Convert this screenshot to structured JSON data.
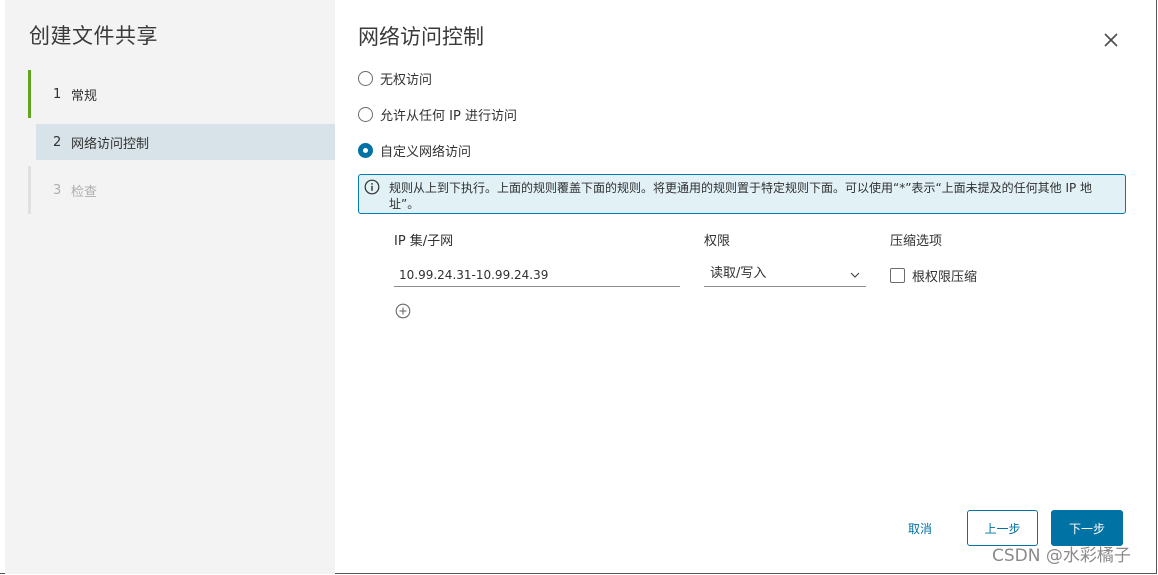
{
  "wizard": {
    "title": "创建文件共享",
    "steps": [
      {
        "num": "1",
        "label": "常规"
      },
      {
        "num": "2",
        "label": "网络访问控制"
      },
      {
        "num": "3",
        "label": "检查"
      }
    ]
  },
  "main": {
    "title": "网络访问控制",
    "options": [
      {
        "label": "无权访问",
        "checked": false
      },
      {
        "label": "允许从任何 IP 进行访问",
        "checked": false
      },
      {
        "label": "自定义网络访问",
        "checked": true
      }
    ],
    "info": "规则从上到下执行。上面的规则覆盖下面的规则。将更通用的规则置于特定规则下面。可以使用“*”表示“上面未提及的任何其他 IP 地址”。",
    "columns": {
      "ip": "IP 集/子网",
      "permission": "权限",
      "squash": "压缩选项"
    },
    "rule": {
      "ip_value": "10.99.24.31-10.99.24.39",
      "permission": "读取/写入",
      "root_squash_label": "根权限压缩",
      "root_squash_checked": false
    }
  },
  "footer": {
    "cancel": "取消",
    "back": "上一步",
    "next": "下一步"
  },
  "watermark": "CSDN @水彩橘子",
  "colors": {
    "accent": "#0072a3",
    "step_done": "#62a420",
    "info_bg": "#e1f1f6"
  }
}
